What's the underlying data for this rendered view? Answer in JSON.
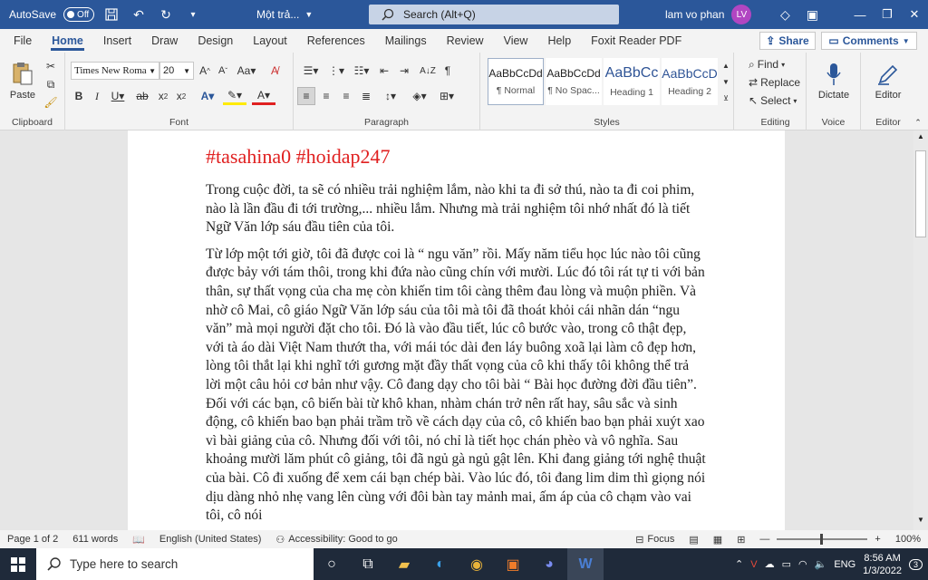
{
  "titlebar": {
    "autosave_label": "AutoSave",
    "autosave_state": "Off",
    "doc_title": "Một trả...",
    "search_placeholder": "Search (Alt+Q)",
    "user_name": "lam vo phan",
    "user_initials": "LV"
  },
  "menu": [
    "File",
    "Home",
    "Insert",
    "Draw",
    "Design",
    "Layout",
    "References",
    "Mailings",
    "Review",
    "View",
    "Help",
    "Foxit Reader PDF"
  ],
  "share_label": "Share",
  "comments_label": "Comments",
  "ribbon": {
    "clipboard": {
      "label": "Clipboard",
      "paste": "Paste"
    },
    "font": {
      "label": "Font",
      "name": "Times New Roma",
      "size": "20"
    },
    "paragraph": {
      "label": "Paragraph"
    },
    "styles": {
      "label": "Styles",
      "items": [
        {
          "sample": "AaBbCcDd",
          "name": "¶ Normal"
        },
        {
          "sample": "AaBbCcDd",
          "name": "¶ No Spac..."
        },
        {
          "sample": "AaBbCc",
          "name": "Heading 1"
        },
        {
          "sample": "AaBbCcD",
          "name": "Heading 2"
        }
      ]
    },
    "editing": {
      "label": "Editing",
      "find": "Find",
      "replace": "Replace",
      "select": "Select"
    },
    "voice": {
      "label": "Voice",
      "dictate": "Dictate"
    },
    "editor": {
      "label": "Editor",
      "editor": "Editor"
    }
  },
  "document": {
    "heading": "#tasahina0 #hoidap247",
    "paragraphs": [
      "Trong cuộc đời, ta sẽ có nhiều trải nghiệm lắm, nào khi ta đi sở thú, nào ta đi coi phim, nào là lần đầu đi tới trường,... nhiều lắm. Nhưng mà trải nghiệm tôi nhớ nhất đó là tiết Ngữ Văn lớp sáu đầu tiên của tôi.",
      "Từ lớp một tới giờ, tôi đã được coi là “ ngu văn” rồi. Mấy năm tiểu học lúc nào tôi cũng được bảy với tám thôi, trong khi đứa nào cũng chín với mười. Lúc đó tôi rát tự ti với bản thân, sự thất vọng của cha mẹ còn khiến tim tôi càng thêm đau lòng và muộn phiền. Và nhờ cô Mai, cô giáo Ngữ Văn lớp sáu của tôi mà tôi đã thoát khỏi cái nhãn dán “ngu văn” mà mọi người đặt cho tôi. Đó là vào đầu tiết, lúc cô bước vào, trong cô thật đẹp, với tà áo dài Việt Nam thướt tha, với mái tóc dài đen láy buông xoã lại làm cô đẹp hơn, lòng tôi thắt lại khi nghĩ tới gương mặt đầy thất vọng của cô khi thấy tôi không thể trả lời một câu hỏi cơ bản như vậy. Cô đang dạy cho tôi bài “ Bài học đường đời đầu tiên”. Đối với các bạn, cô biến bài từ khô khan, nhàm chán trở nên rất hay, sâu sắc và sinh động, cô khiến bao bạn phải trầm trồ về cách dạy của cô, cô khiến bao bạn phải xuýt xao vì bài giảng của cô. Nhưng đối với tôi, nó chỉ là tiết học chán phèo và vô nghĩa. Sau khoảng mười lăm phút cô giảng, tôi đã ngủ gà ngủ gật lên. Khi đang giảng tới nghệ thuật của bài. Cô đi xuống để xem cái bạn chép bài. Vào lúc đó, tôi đang lim dim thì giọng nói dịu dàng nhỏ nhẹ vang lên cùng với đôi bàn tay mảnh mai, ấm áp của cô chạm vào vai tôi, cô nói"
    ]
  },
  "status": {
    "page": "Page 1 of 2",
    "words": "611 words",
    "language": "English (United States)",
    "accessibility": "Accessibility: Good to go",
    "focus": "Focus",
    "zoom": "100%"
  },
  "taskbar": {
    "search_placeholder": "Type here to search",
    "lang": "ENG",
    "time": "8:56 AM",
    "date": "1/3/2022",
    "notif": "3"
  }
}
